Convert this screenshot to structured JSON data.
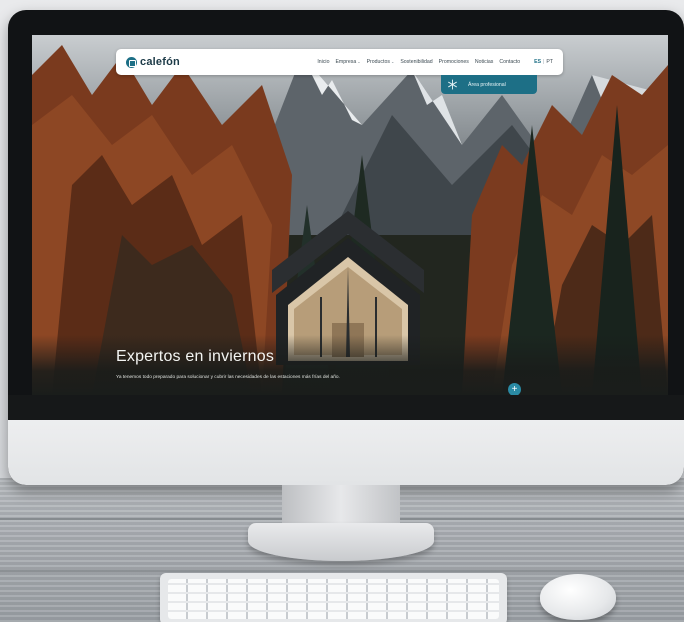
{
  "site": {
    "logo_text": "calefón",
    "nav": {
      "items": [
        {
          "label": "Inicio"
        },
        {
          "label": "Empresa",
          "has_dropdown": true
        },
        {
          "label": "Productos",
          "has_dropdown": true
        },
        {
          "label": "Sostenibilidad"
        },
        {
          "label": "Promociones"
        },
        {
          "label": "Noticias"
        },
        {
          "label": "Contacto"
        }
      ],
      "languages": {
        "es": "ES",
        "separator": "|",
        "pt": "PT"
      }
    },
    "pro_button_label": "Área profesional",
    "hero": {
      "title": "Expertos en inviernos",
      "subtitle": "Ya tenemos todo preparado para solucionar y cubrir las necesidades de las estaciones más frías del año."
    },
    "colors": {
      "accent": "#1d6f86",
      "nav_bg": "#ffffff"
    },
    "icons": [
      "logo-icon",
      "chevron-down-icon",
      "snowflake-icon",
      "plus-icon"
    ]
  }
}
